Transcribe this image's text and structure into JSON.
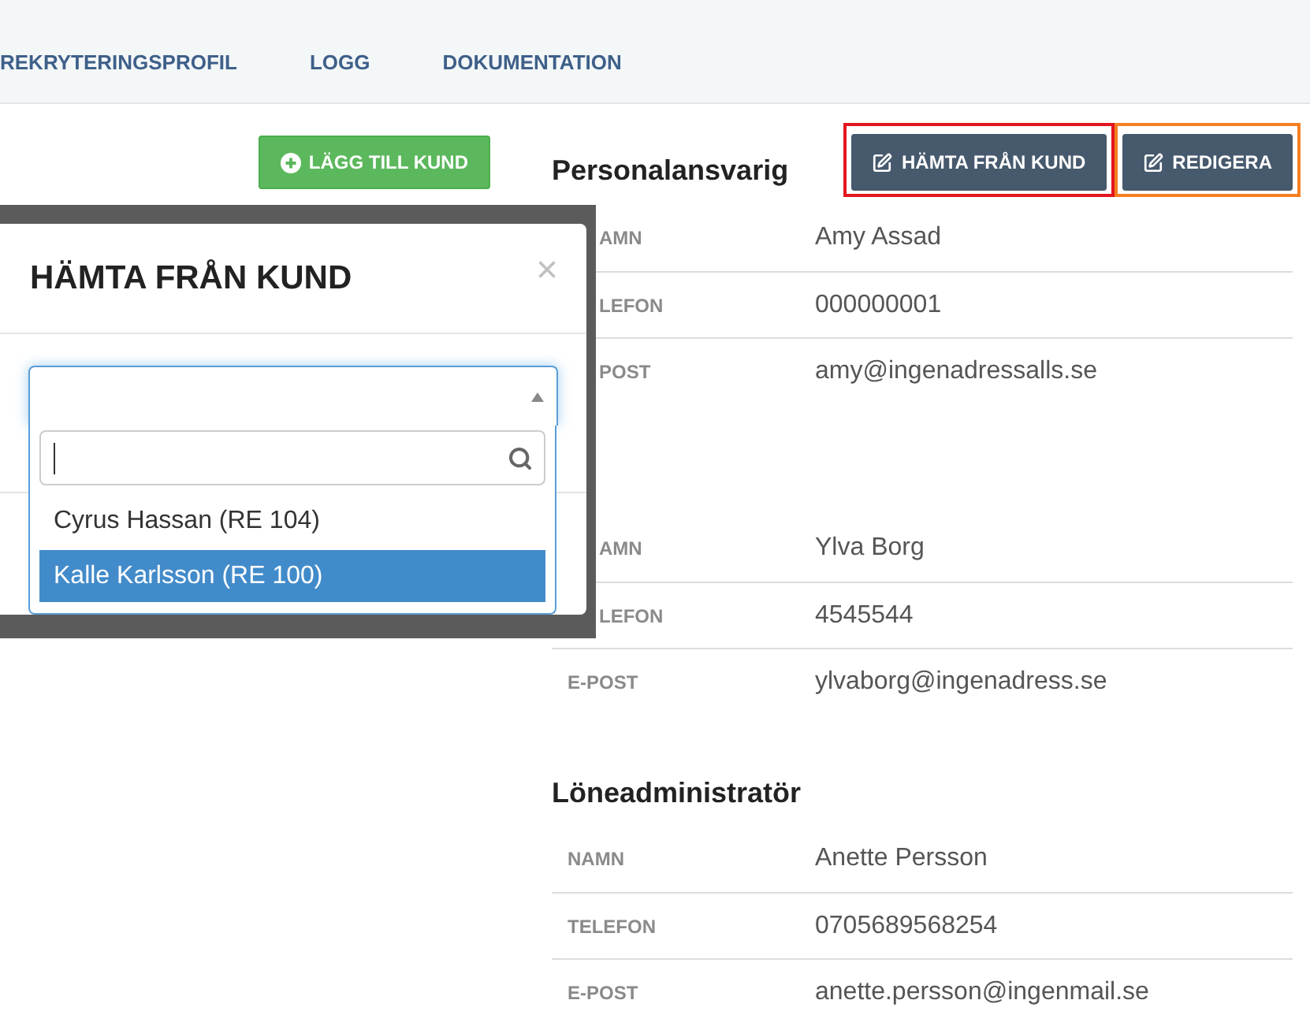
{
  "nav_tabs": [
    {
      "label": "REKRYTERINGSPROFIL",
      "selected": false
    },
    {
      "label": "LOGG",
      "selected": false
    },
    {
      "label": "DOKUMENTATION",
      "selected": false
    }
  ],
  "add_customer_button": {
    "label": "LÄGG TILL KUND"
  },
  "contacts": {
    "actions": [
      {
        "label": "HÄMTA FRÅN KUND",
        "color": "#e3161e"
      },
      {
        "label": "REDIGERA",
        "color": "#f57e20"
      }
    ],
    "sections": [
      {
        "heading": "Personalansvarig",
        "rows": [
          {
            "label": "AMN",
            "value": "Amy Assad"
          },
          {
            "label": "LEFON",
            "value": "000000001"
          },
          {
            "label": "POST",
            "value": "amy@ingenadressalls.se"
          }
        ]
      },
      {
        "rows": [
          {
            "label": "AMN",
            "value": "Ylva Borg"
          },
          {
            "label": "LEFON",
            "value": "4545544"
          },
          {
            "label": "E-POST",
            "value": "ylvaborg@ingenadress.se"
          }
        ]
      },
      {
        "heading": "Löneadministratör",
        "rows": [
          {
            "label": "NAMN",
            "value": "Anette Persson"
          },
          {
            "label": "TELEFON",
            "value": "0705689568254"
          },
          {
            "label": "E-POST",
            "value": "anette.persson@ingenmail.se"
          }
        ]
      }
    ]
  },
  "dialog": {
    "title": "HÄMTA FRÅN KUND",
    "close": "×",
    "select": {
      "expanded": true
    },
    "search": {
      "focused": true
    },
    "options": [
      {
        "label": "Cyrus Hassan (RE 104)",
        "selected": false
      },
      {
        "label": "Kalle Karlsson (RE 100)",
        "selected": true
      }
    ]
  }
}
